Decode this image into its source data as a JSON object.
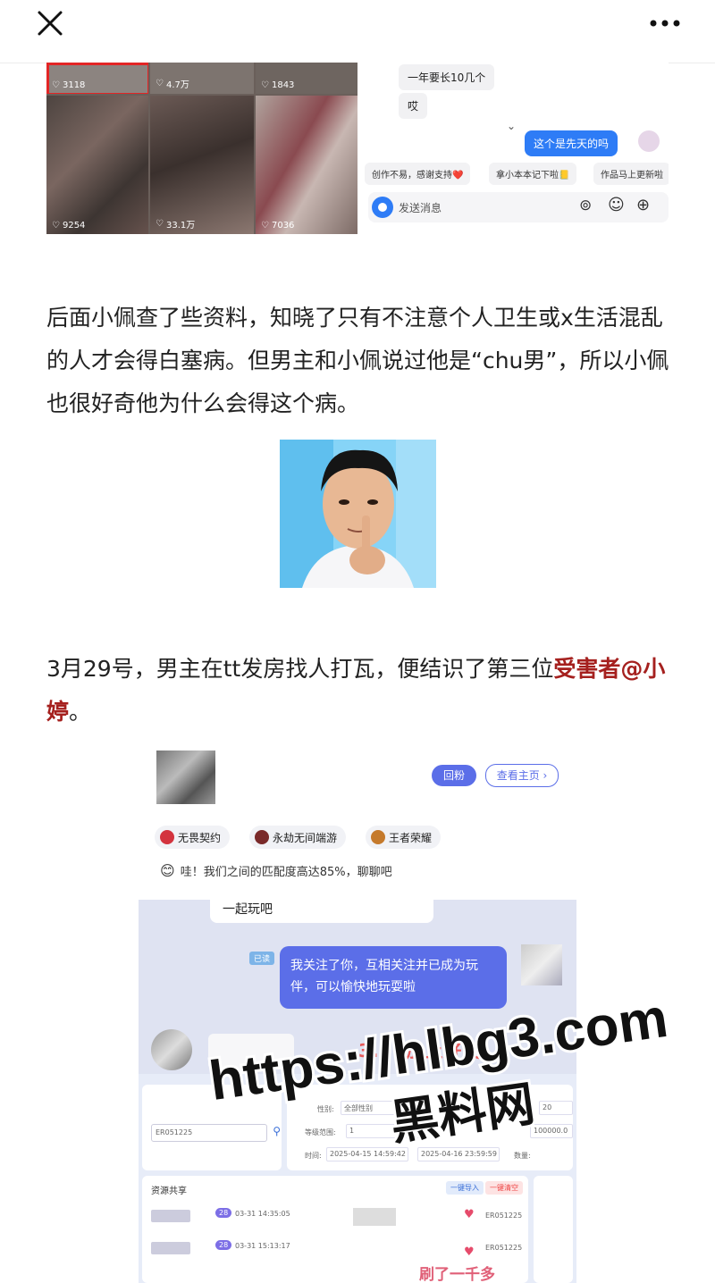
{
  "topbar": {
    "close_icon": "close-icon",
    "more_icon": "more-icon"
  },
  "shot1": {
    "tiles": [
      {
        "likes": "3118"
      },
      {
        "likes": "4.7万"
      },
      {
        "likes": "1843"
      },
      {
        "likes": "9254"
      },
      {
        "likes": "33.1万"
      },
      {
        "likes": "7036"
      }
    ],
    "msg1": "一年要长10几个",
    "msg2": "哎",
    "msg3": "这个是先天的吗",
    "tags": [
      "创作不易，感谢支持❤️",
      "拿小本本记下啦📒",
      "作品马上更新啦"
    ],
    "input_placeholder": "发送消息"
  },
  "para1": "后面小佩查了些资料，知晓了只有不注意个人卫生或x生活混乱的人才会得白塞病。但男主和小佩说过他是“chu男”，所以小佩也很好奇他为什么会得这个病。",
  "para2_a": "3月29号，男主在tt发房找人打瓦，便结识了第三位",
  "para2_red": "受害者@小婷",
  "para2_b": "。",
  "shot2": {
    "follow_back": "回粉",
    "view_profile": "查看主页 ›",
    "games": [
      "无畏契约",
      "永劫无间端游",
      "王者荣耀"
    ],
    "match": "哇！我们之间的匹配度高达85%，聊聊吧",
    "msg_play": "一起玩吧",
    "read": "已读",
    "msg_follow": "我关注了你，互相关注并已成为玩伴，可以愉快地玩耍啦",
    "stamp": "3.29加上好友",
    "search_value": "ER051225",
    "field_gender": "性别:",
    "field_gender_val": "全部性别",
    "field_level": "等级范围:",
    "field_level_from": "1",
    "field_time": "时间:",
    "time_from": "2025-04-15 14:59:42",
    "time_to": "2025-04-16 23:59:59",
    "field_qty": "数量:",
    "qty_val": "20",
    "price_val": "100000.0",
    "resource_title": "资源共享",
    "btn_import": "一键导入",
    "btn_clear": "一键清空",
    "row_id": "ER051225",
    "row_time1": "03-31 14:35:05",
    "row_time2": "03-31 15:13:17",
    "row_level": "28",
    "note": "刷了一千多"
  },
  "watermark": {
    "line1": "https://hlbg3.com",
    "line2": "黑料网"
  }
}
